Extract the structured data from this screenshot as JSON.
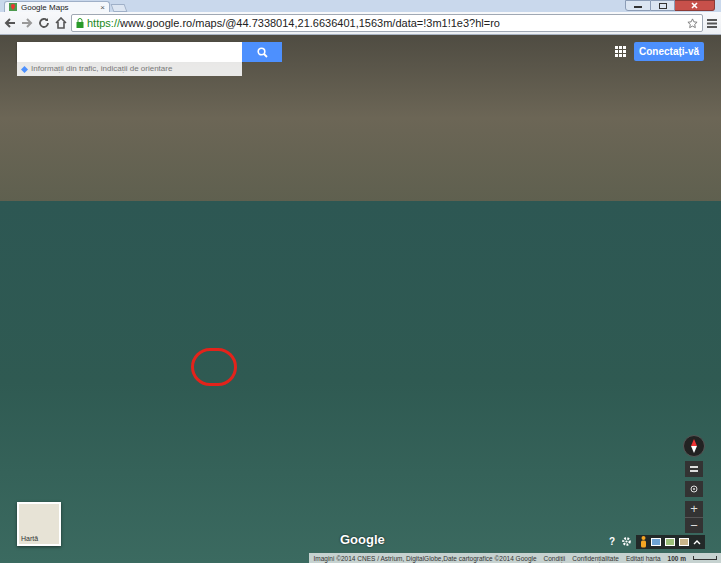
{
  "browser": {
    "tab": {
      "title": "Google Maps",
      "close": "×"
    },
    "address": {
      "scheme": "https://",
      "rest": "www.google.ro/maps/@44.7338014,21.6636401,1563m/data=!3m1!1e3?hl=ro",
      "secure": true
    }
  },
  "search": {
    "placeholder": "",
    "hint": "Informații din trafic, indicații de orientare"
  },
  "header": {
    "sign_in": "Conectați-vă"
  },
  "map": {
    "marker": {
      "kind": "circle",
      "color": "#e3231b"
    }
  },
  "layer_switch": {
    "label": "Hartă"
  },
  "logo": "Google",
  "zoom": {
    "in": "+",
    "out": "−"
  },
  "help": "?",
  "footer": {
    "attribution": "Imagini ©2014 CNES / Astrium, DigitalGlobe,Date cartografice ©2014 Google",
    "links": [
      "Condiții",
      "Confidențialitate",
      "Editați harta"
    ],
    "scale": "100 m"
  }
}
